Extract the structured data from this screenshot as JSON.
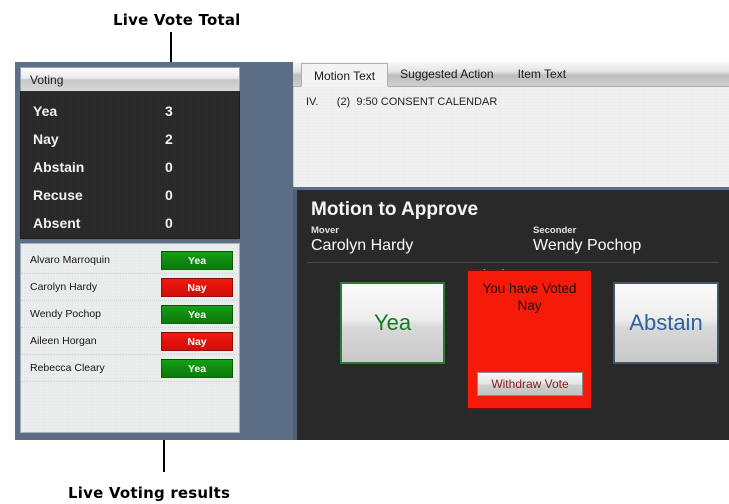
{
  "annotations": {
    "top": "Live Vote Total",
    "bottom": "Live Voting results"
  },
  "left_panel": {
    "header_title": "Voting",
    "totals": [
      {
        "label": "Yea",
        "value": "3"
      },
      {
        "label": "Nay",
        "value": "2"
      },
      {
        "label": "Abstain",
        "value": "0"
      },
      {
        "label": "Recuse",
        "value": "0"
      },
      {
        "label": "Absent",
        "value": "0"
      }
    ],
    "members": [
      {
        "name": "Alvaro Marroquin",
        "vote": "Yea",
        "vote_kind": "yea"
      },
      {
        "name": "Carolyn Hardy",
        "vote": "Nay",
        "vote_kind": "nay"
      },
      {
        "name": "Wendy Pochop",
        "vote": "Yea",
        "vote_kind": "yea"
      },
      {
        "name": "Aileen Horgan",
        "vote": "Nay",
        "vote_kind": "nay"
      },
      {
        "name": "Rebecca Cleary",
        "vote": "Yea",
        "vote_kind": "yea"
      }
    ]
  },
  "right_panel": {
    "tabs": [
      {
        "label": "Motion Text",
        "active": true
      },
      {
        "label": "Suggested Action",
        "active": false
      },
      {
        "label": "Item Text",
        "active": false
      }
    ],
    "motion_text_body": "IV.      (2)  9:50 CONSENT CALENDAR",
    "motion": {
      "title": "Motion to Approve",
      "mover_role": "Mover",
      "mover_name": "Carolyn Hardy",
      "seconder_role": "Seconder",
      "seconder_name": "Wendy Pochop",
      "status": "Voting in Progress"
    },
    "vote_controls": {
      "yea_label": "Yea",
      "abstain_label": "Abstain",
      "voted_message": "You have Voted\nNay",
      "withdraw_label": "Withdraw Vote"
    }
  },
  "colors": {
    "window_chrome": "#5b6e85",
    "dark_panel": "#262626",
    "yea_green": "#0f8a0f",
    "nay_red": "#e0130b",
    "voted_red": "#f51a0a",
    "abstain_blue": "#2f5f9e"
  }
}
